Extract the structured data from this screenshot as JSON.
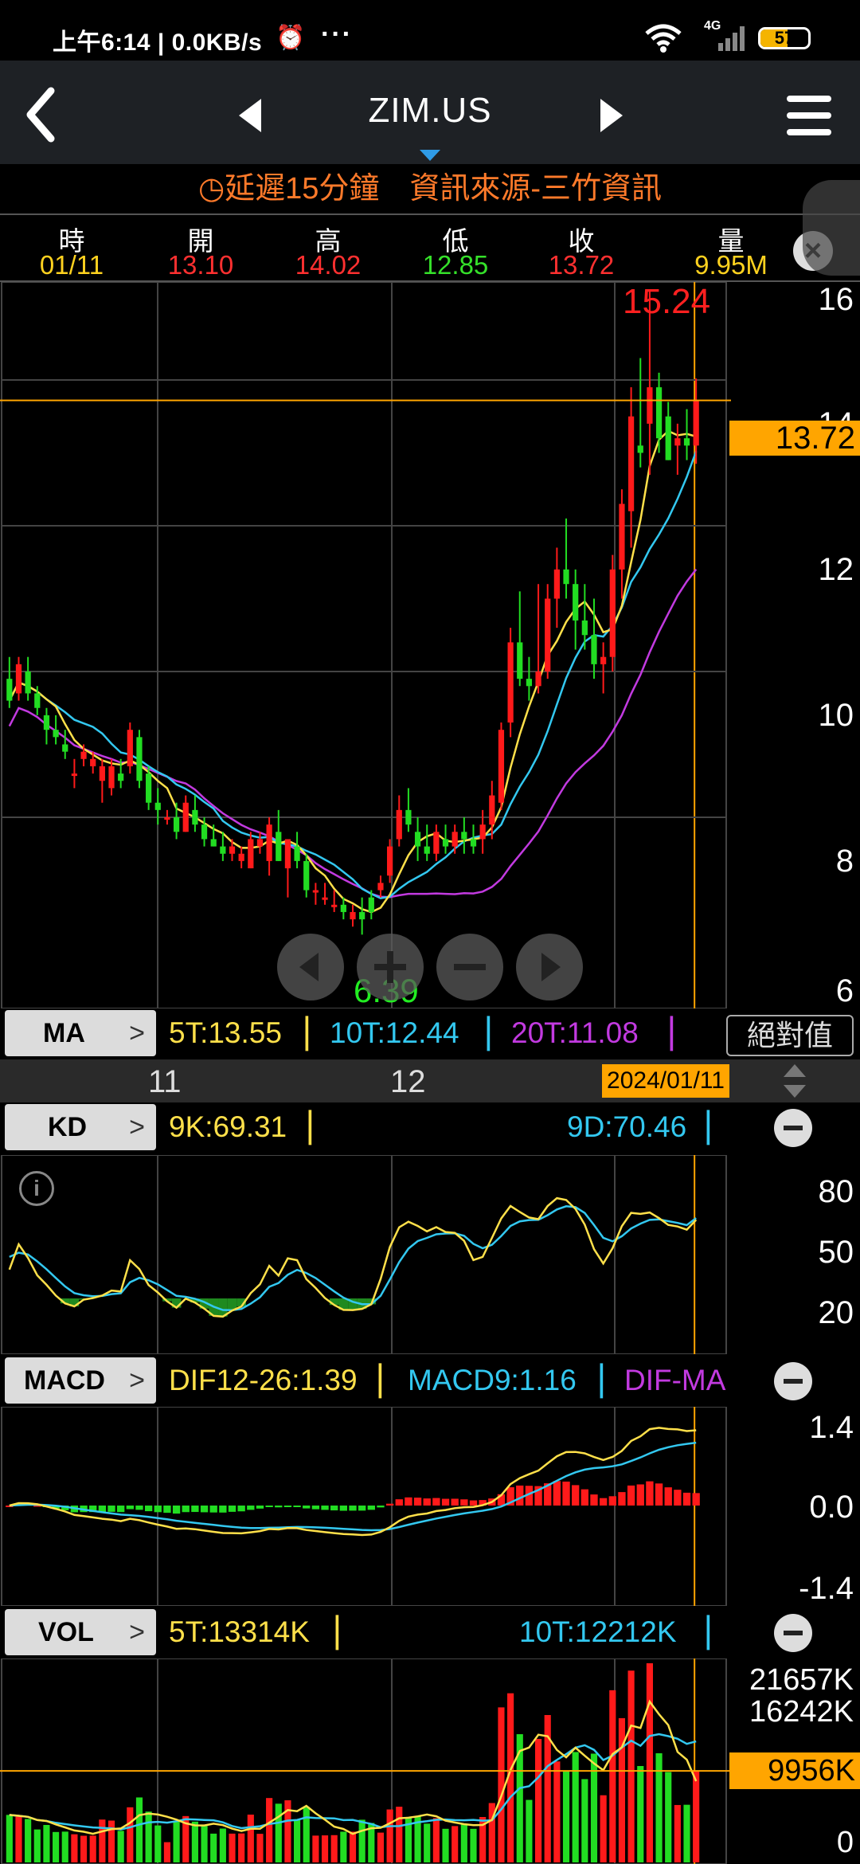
{
  "status_bar": {
    "time_speed": "上午6:14 | 0.0KB/s",
    "network": "4G",
    "battery": "57"
  },
  "nav": {
    "title": "ZIM.US"
  },
  "delay_notice": "延遲15分鐘　資訊來源-三竹資訊",
  "ohlc": {
    "headers": [
      "時",
      "開",
      "高",
      "低",
      "收",
      "量"
    ],
    "values": [
      "01/11",
      "13.10",
      "14.02",
      "12.85",
      "13.72",
      "9.95M"
    ],
    "colors": [
      "#ffd21f",
      "#ff3030",
      "#ff3030",
      "#35e12a",
      "#ff3030",
      "#ffd21f"
    ]
  },
  "price_panel": {
    "axis_labels": [
      "16",
      "14",
      "12",
      "10",
      "8",
      "6"
    ],
    "high_marker": "15.24",
    "low_marker": "6.39",
    "last_price": "13.72"
  },
  "ma": {
    "label": "MA",
    "ma5": "5T:13.55",
    "ma10": "10T:12.44",
    "ma20": "20T:11.08",
    "abs_button": "絕對值"
  },
  "time_axis": {
    "labels": [
      "11",
      "12"
    ],
    "current": "2024/01/11"
  },
  "kd": {
    "label": "KD",
    "k": "9K:69.31",
    "d": "9D:70.46",
    "axis": [
      "80",
      "50",
      "20"
    ]
  },
  "macd": {
    "label": "MACD",
    "dif": "DIF12-26:1.39",
    "macd9": "MACD9:1.16",
    "difma": "DIF-MA",
    "axis": [
      "1.4",
      "0.0",
      "-1.4"
    ]
  },
  "vol": {
    "label": "VOL",
    "ma5": "5T:13314K",
    "ma10": "10T:12212K",
    "axis": [
      "21657K",
      "16242K",
      "0"
    ],
    "last": "9956K"
  },
  "colors": {
    "up": "#ff1a1a",
    "down": "#22dd22",
    "ma5": "#ffe04a",
    "ma10": "#33c8f0",
    "ma20": "#c23ae0",
    "accent": "#ffa500"
  },
  "chart_data": {
    "type": "candlestick",
    "ylim": [
      6,
      16
    ],
    "x_month_labels": [
      "11",
      "12"
    ],
    "candles_ohlc": [
      [
        9.9,
        10.2,
        9.5,
        9.6
      ],
      [
        9.7,
        10.2,
        9.6,
        10.1
      ],
      [
        10.0,
        10.2,
        9.6,
        9.7
      ],
      [
        9.7,
        9.8,
        9.4,
        9.5
      ],
      [
        9.4,
        9.5,
        9.0,
        9.2
      ],
      [
        9.2,
        9.4,
        9.0,
        9.1
      ],
      [
        9.0,
        9.2,
        8.8,
        8.9
      ],
      [
        8.6,
        8.8,
        8.4,
        8.6
      ],
      [
        8.8,
        9.0,
        8.7,
        8.9
      ],
      [
        8.7,
        8.9,
        8.6,
        8.8
      ],
      [
        8.5,
        8.8,
        8.2,
        8.7
      ],
      [
        8.4,
        8.8,
        8.3,
        8.7
      ],
      [
        8.6,
        8.8,
        8.4,
        8.5
      ],
      [
        8.7,
        9.3,
        8.6,
        9.2
      ],
      [
        9.1,
        9.2,
        8.4,
        8.5
      ],
      [
        8.6,
        8.7,
        8.1,
        8.2
      ],
      [
        8.2,
        8.4,
        7.9,
        8.1
      ],
      [
        8.0,
        8.1,
        7.9,
        8.0
      ],
      [
        8.0,
        8.2,
        7.7,
        7.8
      ],
      [
        7.8,
        8.3,
        7.8,
        8.2
      ],
      [
        8.1,
        8.3,
        7.8,
        7.9
      ],
      [
        7.9,
        8.0,
        7.6,
        7.7
      ],
      [
        7.7,
        7.9,
        7.6,
        7.6
      ],
      [
        7.6,
        7.8,
        7.4,
        7.5
      ],
      [
        7.5,
        7.7,
        7.4,
        7.6
      ],
      [
        7.4,
        7.6,
        7.3,
        7.5
      ],
      [
        7.3,
        7.8,
        7.3,
        7.7
      ],
      [
        7.6,
        7.8,
        7.5,
        7.7
      ],
      [
        7.4,
        8.0,
        7.2,
        7.9
      ],
      [
        7.8,
        8.1,
        7.4,
        7.4
      ],
      [
        7.3,
        7.7,
        6.9,
        7.7
      ],
      [
        7.6,
        7.8,
        7.3,
        7.4
      ],
      [
        7.4,
        7.5,
        6.9,
        7.0
      ],
      [
        7.0,
        7.1,
        6.8,
        7.0
      ],
      [
        6.9,
        7.1,
        6.8,
        6.9
      ],
      [
        6.8,
        7.0,
        6.7,
        6.8
      ],
      [
        6.8,
        6.9,
        6.6,
        6.7
      ],
      [
        6.6,
        6.8,
        6.5,
        6.7
      ],
      [
        6.7,
        6.9,
        6.39,
        6.6
      ],
      [
        6.9,
        7.0,
        6.6,
        6.7
      ],
      [
        7.0,
        7.2,
        6.9,
        7.1
      ],
      [
        7.2,
        7.7,
        7.1,
        7.6
      ],
      [
        7.7,
        8.3,
        7.6,
        8.1
      ],
      [
        8.1,
        8.4,
        7.8,
        7.9
      ],
      [
        7.8,
        8.0,
        7.4,
        7.6
      ],
      [
        7.6,
        7.9,
        7.4,
        7.5
      ],
      [
        7.5,
        7.9,
        7.4,
        7.8
      ],
      [
        7.7,
        7.9,
        7.5,
        7.6
      ],
      [
        7.6,
        7.9,
        7.5,
        7.8
      ],
      [
        7.8,
        8.0,
        7.5,
        7.7
      ],
      [
        7.7,
        7.9,
        7.5,
        7.6
      ],
      [
        7.7,
        8.1,
        7.5,
        7.9
      ],
      [
        7.9,
        8.5,
        7.7,
        8.3
      ],
      [
        8.2,
        9.3,
        8.1,
        9.2
      ],
      [
        9.3,
        10.6,
        9.1,
        10.4
      ],
      [
        10.4,
        11.1,
        9.8,
        9.9
      ],
      [
        9.9,
        10.2,
        9.6,
        9.8
      ],
      [
        9.8,
        11.2,
        9.7,
        10.0
      ],
      [
        10.0,
        11.2,
        9.9,
        11.0
      ],
      [
        11.0,
        11.7,
        10.6,
        11.4
      ],
      [
        11.4,
        12.1,
        11.0,
        11.2
      ],
      [
        11.2,
        11.4,
        10.3,
        10.7
      ],
      [
        10.7,
        11.2,
        10.3,
        10.5
      ],
      [
        10.5,
        11.0,
        9.9,
        10.1
      ],
      [
        10.1,
        10.4,
        9.7,
        10.2
      ],
      [
        10.2,
        11.6,
        10.0,
        11.4
      ],
      [
        11.4,
        12.5,
        11.0,
        12.3
      ],
      [
        12.2,
        13.9,
        11.7,
        13.5
      ],
      [
        13.1,
        14.3,
        12.8,
        13.0
      ],
      [
        13.4,
        15.24,
        12.7,
        13.9
      ],
      [
        13.9,
        14.1,
        13.0,
        13.2
      ],
      [
        13.5,
        13.7,
        12.9,
        12.9
      ],
      [
        13.1,
        13.4,
        12.7,
        13.2
      ],
      [
        13.2,
        13.6,
        12.9,
        13.1
      ],
      [
        13.1,
        14.02,
        12.85,
        13.72
      ]
    ],
    "kd_k_last": 69.31,
    "kd_d_last": 70.46,
    "macd_dif_last": 1.39,
    "macd_signal_last": 1.16,
    "vol_ma5_last_k": 13314,
    "vol_ma10_last_k": 12212,
    "vol_last_k": 9956,
    "vol_max_k": 21657
  }
}
